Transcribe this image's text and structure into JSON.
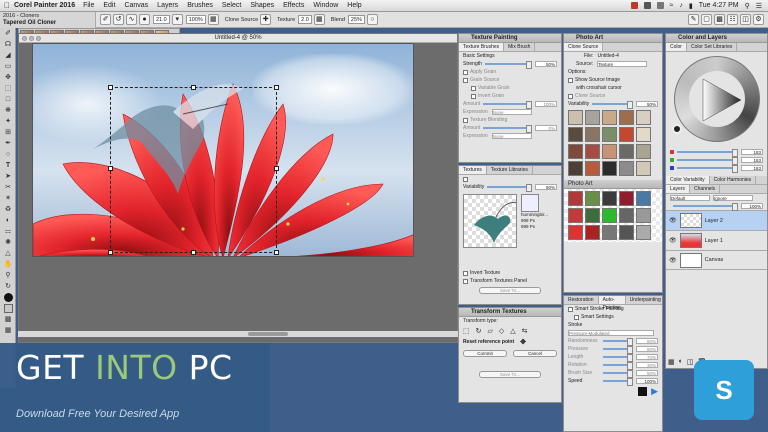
{
  "menubar": {
    "app_name": "Corel Painter 2016",
    "items": [
      "File",
      "Edit",
      "Canvas",
      "Layers",
      "Brushes",
      "Select",
      "Shapes",
      "Effects",
      "Window",
      "Help"
    ],
    "clock": "Tue 4:27 PM",
    "search_placeholder": ""
  },
  "brush": {
    "category": "2016 - Cloners",
    "variant": "Tapered Oil Cloner",
    "strip": [
      "Tapered",
      "Soft",
      "Auto",
      "Impr",
      "Spect",
      "Water",
      "Hard",
      "Art P",
      "Tapered"
    ]
  },
  "propbar": {
    "size": "21.0",
    "opacity": "100%",
    "clone_source_label": "Clone Source",
    "texture_label": "Texture",
    "texture_value": "2.0",
    "blend_label": "Blend",
    "blend_value": "25%"
  },
  "canvas": {
    "title": "Untitled-4 @ 50%"
  },
  "texture_painting": {
    "title": "Texture Painting",
    "tabs": [
      "Texture Brushes",
      "Mix Brush"
    ],
    "basic_settings": "Basic Settings",
    "strength_label": "Strength",
    "strength_value": "50%",
    "rows": [
      "Apply Grain",
      "Grain Source",
      "Variable Grain",
      "Invert Grain",
      "Amount",
      "Expression",
      "Texture Blending",
      "Amount",
      "Expression"
    ],
    "grain_amount": "100%",
    "blend_amount": "0%",
    "none": "None"
  },
  "textures": {
    "tabs": [
      "Textures",
      "Texture Libraries"
    ],
    "variability": "Variability",
    "var_value": "50%",
    "tex_name": "hummingbir...",
    "tex_w": "999 Px",
    "tex_h": "999 Px",
    "invert": "Invert Texture",
    "transform": "Transform Textures Panel",
    "save": "Save To..."
  },
  "transform": {
    "title": "Transform Textures",
    "type_label": "Transform type:",
    "reset": "Reset reference point",
    "commit": "Commit",
    "cancel": "Cancel",
    "save": "Save To..."
  },
  "photo_art": {
    "title": "Photo Art",
    "tab": "Clone Source",
    "file_label": "File:",
    "file_value": "Untitled-4",
    "source_label": "Source:",
    "source_value": "Texture",
    "options": "Options:",
    "opt1": "Show Source Image",
    "opt2": "with crosshair cursor",
    "opt3": "Clone Source",
    "variability": "Variability",
    "var_value": "50%",
    "panel2": "Photo Art"
  },
  "auto_painting": {
    "tabs": [
      "Restoration",
      "Auto-Painting",
      "Underpainting"
    ],
    "smart_stroke": "Smart Stroke Painting",
    "smart_settings": "Smart Settings",
    "stroke_label": "Stroke",
    "stroke_value": "Pressure-Modulated",
    "rows": [
      {
        "label": "Randomness",
        "value": "80%"
      },
      {
        "label": "Pressure",
        "value": "80%"
      },
      {
        "label": "Length",
        "value": "70%"
      },
      {
        "label": "Rotation",
        "value": "30%"
      },
      {
        "label": "Brush Size",
        "value": "50%"
      }
    ],
    "speed_label": "Speed",
    "speed_value": "100%"
  },
  "color_layers": {
    "title": "Color and Layers",
    "color_tabs": [
      "Color",
      "Color Set Libraries"
    ],
    "rgb": [
      "183",
      "183",
      "183"
    ],
    "variability": "Color Variability",
    "harmonies": "Color Harmonies",
    "layer_tabs": [
      "Layers",
      "Channels"
    ],
    "blend_mode": "Default",
    "composite": "Ignore",
    "opacity": "100%",
    "layers": [
      "Layer 2",
      "Layer 1",
      "Canvas"
    ]
  },
  "banner": {
    "title_a": "GET ",
    "title_b": "INTO",
    "title_c": " PC",
    "subtitle": "Download Free Your Desired App"
  },
  "watermark_glyph": "S",
  "colors": {
    "accent": "#7aa3d6",
    "selected_layer": "#b7d1f3",
    "banner": "#345a86",
    "banner_accent": "#9cc87a"
  }
}
